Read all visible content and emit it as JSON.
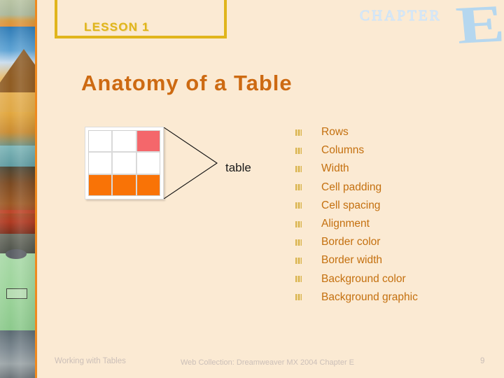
{
  "slide": {
    "background_color": "#FBEAD3",
    "accent_orange": "#EF8A1F",
    "title_color": "#CD6A12",
    "gold_color": "#E0B51C"
  },
  "lesson_banner": {
    "label": "LESSON 1"
  },
  "chapter_marker": {
    "word": "CHAPTER",
    "letter": "E",
    "color": "#A9D4F5"
  },
  "header": {
    "title": "Anatomy of a Table"
  },
  "diagram": {
    "callout_label": "table",
    "table_cells": [
      {
        "name": "r1c1",
        "color": "#FFFFFF"
      },
      {
        "name": "r1c2",
        "color": "#FFFFFF"
      },
      {
        "name": "r1c3",
        "color": "#F4676B"
      },
      {
        "name": "r2c1",
        "color": "#FFFFFF"
      },
      {
        "name": "r2c2",
        "color": "#FFFFFF"
      },
      {
        "name": "r2c3",
        "color": "#FFFFFF"
      },
      {
        "name": "r3c1",
        "color": "#F97306"
      },
      {
        "name": "r3c2",
        "color": "#F97306"
      },
      {
        "name": "r3c3",
        "color": "#F97306"
      }
    ]
  },
  "bullets": {
    "items": [
      {
        "label": "Rows"
      },
      {
        "label": "Columns"
      },
      {
        "label": "Width"
      },
      {
        "label": "Cell padding"
      },
      {
        "label": "Cell spacing"
      },
      {
        "label": "Alignment"
      },
      {
        "label": "Border color"
      },
      {
        "label": "Border width"
      },
      {
        "label": "Background color"
      },
      {
        "label": "Background graphic"
      }
    ]
  },
  "footer": {
    "left": "Working with Tables",
    "center": "Web Collection: Dreamweaver MX 2004 Chapter E",
    "page": "9"
  }
}
